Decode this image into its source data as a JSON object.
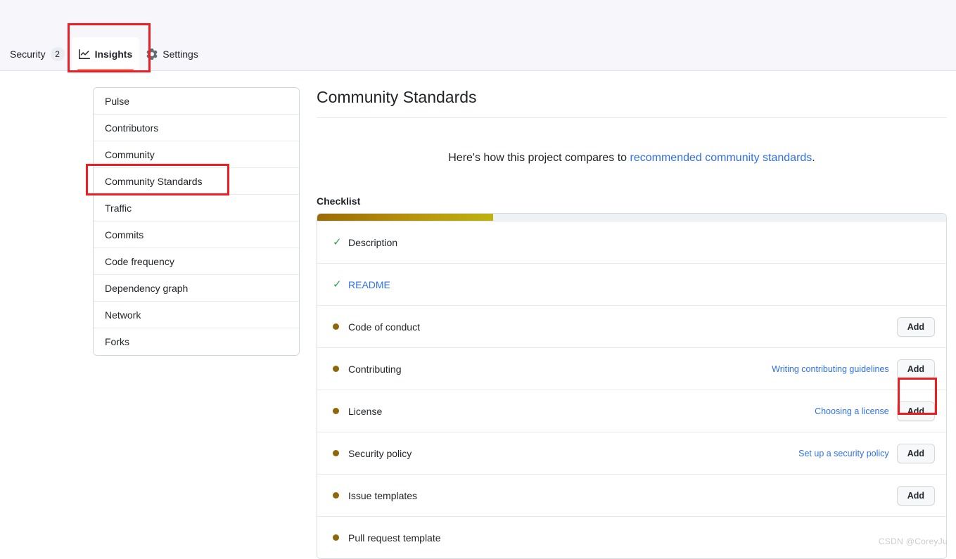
{
  "header": {
    "tabs": [
      {
        "label": "Security",
        "icon": "shield-icon",
        "badge": "2",
        "active": false
      },
      {
        "label": "Insights",
        "icon": "graph-icon",
        "badge": "",
        "active": true
      },
      {
        "label": "Settings",
        "icon": "gear-icon",
        "badge": "",
        "active": false
      }
    ]
  },
  "sidebar": {
    "items": [
      {
        "label": "Pulse"
      },
      {
        "label": "Contributors"
      },
      {
        "label": "Community"
      },
      {
        "label": "Community Standards"
      },
      {
        "label": "Traffic"
      },
      {
        "label": "Commits"
      },
      {
        "label": "Code frequency"
      },
      {
        "label": "Dependency graph"
      },
      {
        "label": "Network"
      },
      {
        "label": "Forks"
      }
    ]
  },
  "main": {
    "title": "Community Standards",
    "intro_prefix": "Here's how this project compares to ",
    "intro_link": "recommended community standards",
    "intro_suffix": ".",
    "checklist_heading": "Checklist",
    "progress_percent": 28,
    "rows": [
      {
        "label": "Description",
        "status": "complete",
        "marker": "check-icon",
        "is_link": false,
        "help": "",
        "button": ""
      },
      {
        "label": "README",
        "status": "complete",
        "marker": "check-icon",
        "is_link": true,
        "help": "",
        "button": ""
      },
      {
        "label": "Code of conduct",
        "status": "incomplete",
        "marker": "dot-icon",
        "is_link": false,
        "help": "",
        "button": "Add"
      },
      {
        "label": "Contributing",
        "status": "incomplete",
        "marker": "dot-icon",
        "is_link": false,
        "help": "Writing contributing guidelines",
        "button": "Add"
      },
      {
        "label": "License",
        "status": "incomplete",
        "marker": "dot-icon",
        "is_link": false,
        "help": "Choosing a license",
        "button": "Add"
      },
      {
        "label": "Security policy",
        "status": "incomplete",
        "marker": "dot-icon",
        "is_link": false,
        "help": "Set up a security policy",
        "button": "Add"
      },
      {
        "label": "Issue templates",
        "status": "incomplete",
        "marker": "dot-icon",
        "is_link": false,
        "help": "",
        "button": "Add"
      },
      {
        "label": "Pull request template",
        "status": "incomplete",
        "marker": "dot-icon",
        "is_link": false,
        "help": "",
        "button": ""
      }
    ]
  },
  "watermark": "CSDN @CoreyJu",
  "colors": {
    "link": "#2f6fed",
    "check_green": "#2da44e",
    "incomplete_dot": "#8d6708",
    "annotation_red": "#ee1c23",
    "active_tab_underline": "#fd8c73",
    "progress_start": "#9b6c05",
    "progress_end": "#bdb30f"
  }
}
